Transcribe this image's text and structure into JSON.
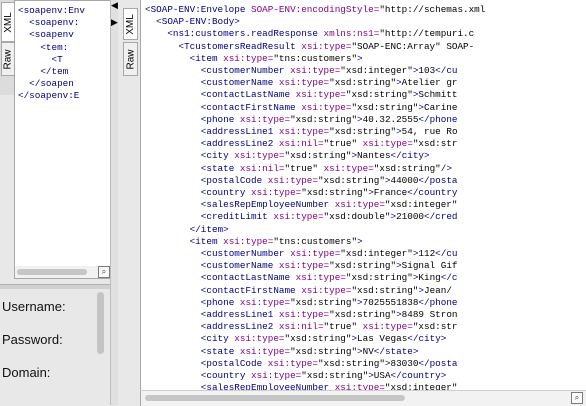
{
  "left_panel": {
    "tabs": {
      "xml": "XML",
      "raw": "Raw"
    },
    "request_lines": [
      "<soapenv:Env",
      "  <soapenv:",
      "  <soapenv",
      "    <tem:",
      "      <T",
      "    </tem",
      "  </soapen",
      "</soapenv:E"
    ],
    "auth": {
      "username_label": "Username:",
      "password_label": "Password:",
      "domain_label": "Domain:"
    }
  },
  "right_panel": {
    "tabs": {
      "xml": "XML",
      "raw": "Raw"
    },
    "response_lines": [
      "<SOAP-ENV:Envelope SOAP-ENV:encodingStyle=\"http://schemas.xml",
      "  <SOAP-ENV:Body>",
      "    <ns1:customers.readResponse xmlns:ns1=\"http://tempuri.c",
      "      <TcustomersReadResult xsi:type=\"SOAP-ENC:Array\" SOAP-",
      "        <item xsi:type=\"tns:customers\">",
      "          <customerNumber xsi:type=\"xsd:integer\">103</cu",
      "          <customerName xsi:type=\"xsd:string\">Atelier gr",
      "          <contactLastName xsi:type=\"xsd:string\">Schmitt",
      "          <contactFirstName xsi:type=\"xsd:string\">Carine",
      "          <phone xsi:type=\"xsd:string\">40.32.2555</phone",
      "          <addressLine1 xsi:type=\"xsd:string\">54, rue Ro",
      "          <addressLine2 xsi:nil=\"true\" xsi:type=\"xsd:str",
      "          <city xsi:type=\"xsd:string\">Nantes</city>",
      "          <state xsi:nil=\"true\" xsi:type=\"xsd:string\"/>",
      "          <postalCode xsi:type=\"xsd:string\">44000</posta",
      "          <country xsi:type=\"xsd:string\">France</country",
      "          <salesRepEmployeeNumber xsi:type=\"xsd:integer\"",
      "          <creditLimit xsi:type=\"xsd:double\">21000</cred",
      "        </item>",
      "        <item xsi:type=\"tns:customers\">",
      "          <customerNumber xsi:type=\"xsd:integer\">112</cu",
      "          <customerName xsi:type=\"xsd:string\">Signal Gif",
      "          <contactLastName xsi:type=\"xsd:string\">King</c",
      "          <contactFirstName xsi:type=\"xsd:string\">Jean</",
      "          <phone xsi:type=\"xsd:string\">7025551838</phone",
      "          <addressLine1 xsi:type=\"xsd:string\">8489 Stron",
      "          <addressLine2 xsi:nil=\"true\" xsi:type=\"xsd:str",
      "          <city xsi:type=\"xsd:string\">Las Vegas</city>",
      "          <state xsi:type=\"xsd:string\">NV</state>",
      "          <postalCode xsi:type=\"xsd:string\">83030</posta",
      "          <country xsi:type=\"xsd:string\">USA</country>",
      "          <salesRepEmployeeNumber xsi:type=\"xsd:integer\""
    ]
  },
  "colors": {
    "tag": "#000080",
    "attribute": "#7f007f",
    "highlight": "#f5f5a8"
  },
  "icons": {
    "magnifier": "magnifier-icon",
    "collapse_left": "arrow-left-icon",
    "collapse_right": "arrow-right-icon"
  }
}
